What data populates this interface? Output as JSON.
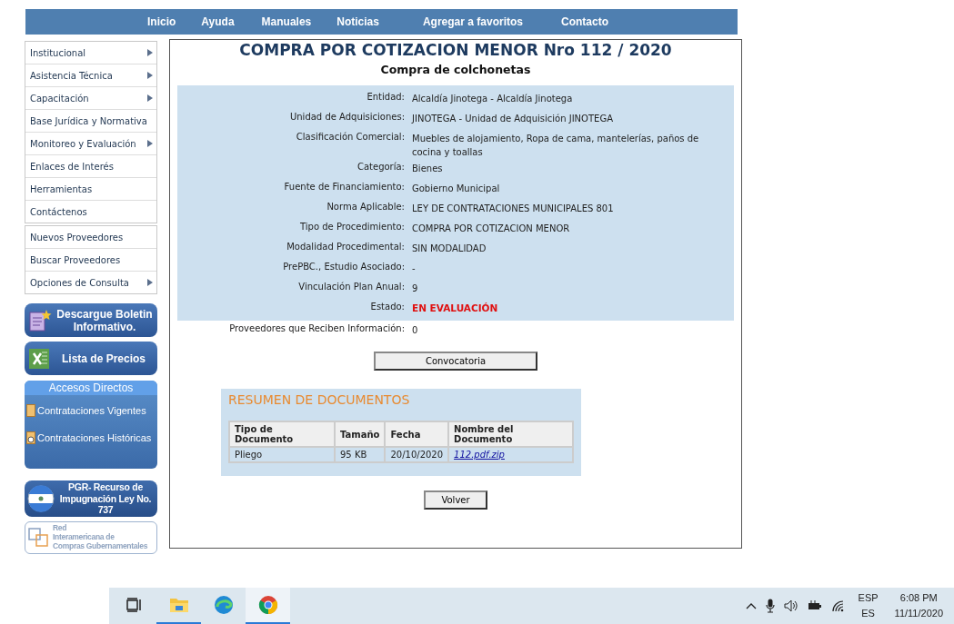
{
  "nav": [
    "Inicio",
    "Ayuda",
    "Manuales",
    "Noticias",
    "Agregar a favoritos",
    "Contacto"
  ],
  "sidebar": {
    "menu_groups": [
      [
        {
          "label": "Institucional",
          "has_submenu": true
        },
        {
          "label": "Asistencia Técnica",
          "has_submenu": true
        },
        {
          "label": "Capacitación",
          "has_submenu": true
        },
        {
          "label": "Base Jurídica y Normativa",
          "has_submenu": false
        },
        {
          "label": "Monitoreo y Evaluación",
          "has_submenu": true
        },
        {
          "label": "Enlaces de Interés",
          "has_submenu": false
        },
        {
          "label": "Herramientas",
          "has_submenu": false
        },
        {
          "label": "Contáctenos",
          "has_submenu": false
        }
      ],
      [
        {
          "label": "Nuevos Proveedores",
          "has_submenu": false
        },
        {
          "label": "Buscar Proveedores",
          "has_submenu": false
        },
        {
          "label": "Opciones de Consulta",
          "has_submenu": true
        }
      ]
    ],
    "promo_buttons": [
      {
        "kind": "document",
        "lines": [
          "Descargue Boletin",
          "Informativo."
        ]
      },
      {
        "kind": "spreadsheet",
        "lines": [
          "Lista de Precios"
        ]
      }
    ],
    "quick_access": {
      "title": "Accesos Directos",
      "links": [
        {
          "kind": "folder",
          "label": "Contrataciones Vigentes"
        },
        {
          "kind": "history",
          "label": "Contrataciones Históricas"
        }
      ]
    },
    "pgr_banner": {
      "lines": [
        "PGR- Recurso de",
        "Impugnación Ley No. 737"
      ]
    },
    "network_logo": {
      "lines": [
        "Red",
        "Interamericana de",
        "Compras Gubernamentales"
      ]
    }
  },
  "main": {
    "title": "COMPRA POR COTIZACION MENOR Nro 112 / 2020",
    "subtitle": "Compra de colchonetas",
    "details": [
      {
        "label": "Entidad:",
        "value": "Alcaldía Jinotega - Alcaldía Jinotega",
        "kind": "text"
      },
      {
        "label": "Unidad de Adquisiciones:",
        "value": "JINOTEGA - Unidad de Adquisición JINOTEGA",
        "kind": "text"
      },
      {
        "label": "Clasificación Comercial:",
        "value": "Muebles de alojamiento, Ropa de cama, mantelerías, paños de cocina y toallas",
        "kind": "text"
      },
      {
        "label": "Categoría:",
        "value": "Bienes",
        "kind": "text"
      },
      {
        "label": "Fuente de Financiamiento:",
        "value": "Gobierno Municipal",
        "kind": "text"
      },
      {
        "label": "Norma Aplicable:",
        "value": "LEY DE CONTRATACIONES MUNICIPALES 801",
        "kind": "text"
      },
      {
        "label": "Tipo de Procedimiento:",
        "value": "COMPRA POR COTIZACION MENOR",
        "kind": "text"
      },
      {
        "label": "Modalidad Procedimental:",
        "value": "SIN MODALIDAD",
        "kind": "text"
      },
      {
        "label": "PrePBC., Estudio Asociado:",
        "value": "-",
        "kind": "text"
      },
      {
        "label": "Vinculación Plan Anual:",
        "value": "9",
        "kind": "text"
      },
      {
        "label": "Estado:",
        "value": "EN EVALUACIÓN",
        "kind": "status"
      }
    ],
    "providers": {
      "label": "Proveedores que Reciben Información:",
      "value": "0"
    },
    "convocatoria_button": "Convocatoria",
    "documents": {
      "title": "RESUMEN DE DOCUMENTOS",
      "columns": [
        "Tipo de Documento",
        "Tamaño",
        "Fecha",
        "Nombre del Documento"
      ],
      "rows": [
        [
          "Pliego",
          "95 KB",
          "20/10/2020",
          "112.pdf.zip"
        ]
      ]
    },
    "back_button": "Volver"
  },
  "taskbar": {
    "apps": [
      {
        "kind": "taskview",
        "selected": false,
        "running": false
      },
      {
        "kind": "folder",
        "selected": false,
        "running": true
      },
      {
        "kind": "edge",
        "selected": false,
        "running": false
      },
      {
        "kind": "chrome",
        "selected": true,
        "running": true
      }
    ],
    "language": [
      "ESP",
      "ES"
    ],
    "time": "6:08 PM",
    "date": "11/11/2020"
  }
}
